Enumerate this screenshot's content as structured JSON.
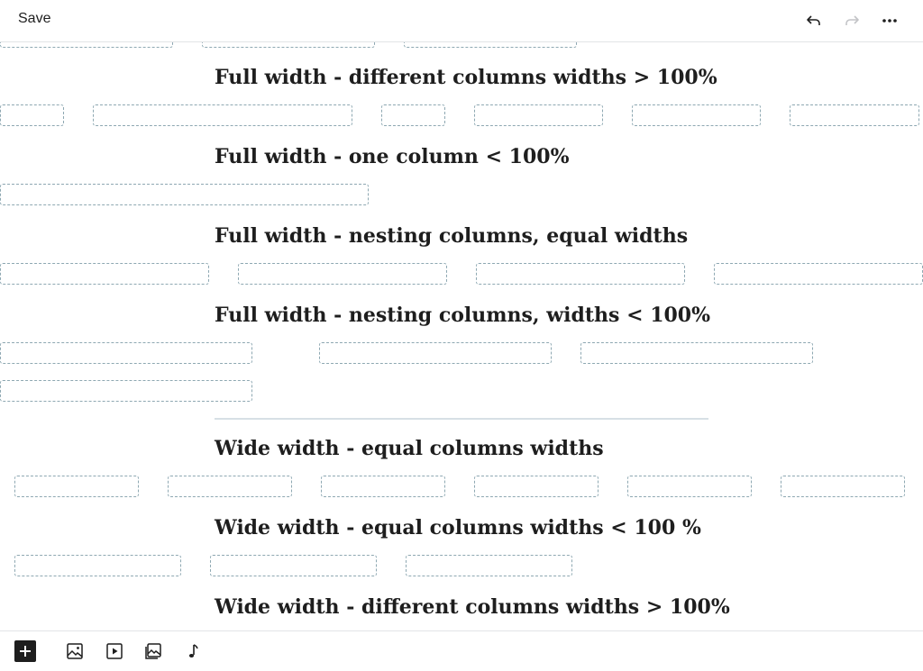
{
  "toolbar": {
    "save_label": "Save",
    "undo_icon": "undo-icon",
    "redo_icon": "redo-icon",
    "more_icon": "more-options-icon"
  },
  "blocks": {
    "h1": "Full width - different columns widths > 100%",
    "h2": "Full width - one column < 100%",
    "h3": "Full width - nesting columns, equal widths",
    "h4": "Full width - nesting columns, widths < 100%",
    "h5": "Wide width - equal columns widths",
    "h6": "Wide width - equal columns widths < 100 %",
    "h7": "Wide width - different columns widths > 100%"
  },
  "bottom_toolbar": {
    "add_icon": "plus-icon",
    "image_icon": "image-icon",
    "video_icon": "video-icon",
    "gallery_icon": "gallery-icon",
    "audio_icon": "audio-icon"
  },
  "colors": {
    "text": "#1e1e1e",
    "column_border": "#8ea8b2",
    "separator": "#d7e0e5",
    "disabled_icon": "#c3c4c7"
  }
}
